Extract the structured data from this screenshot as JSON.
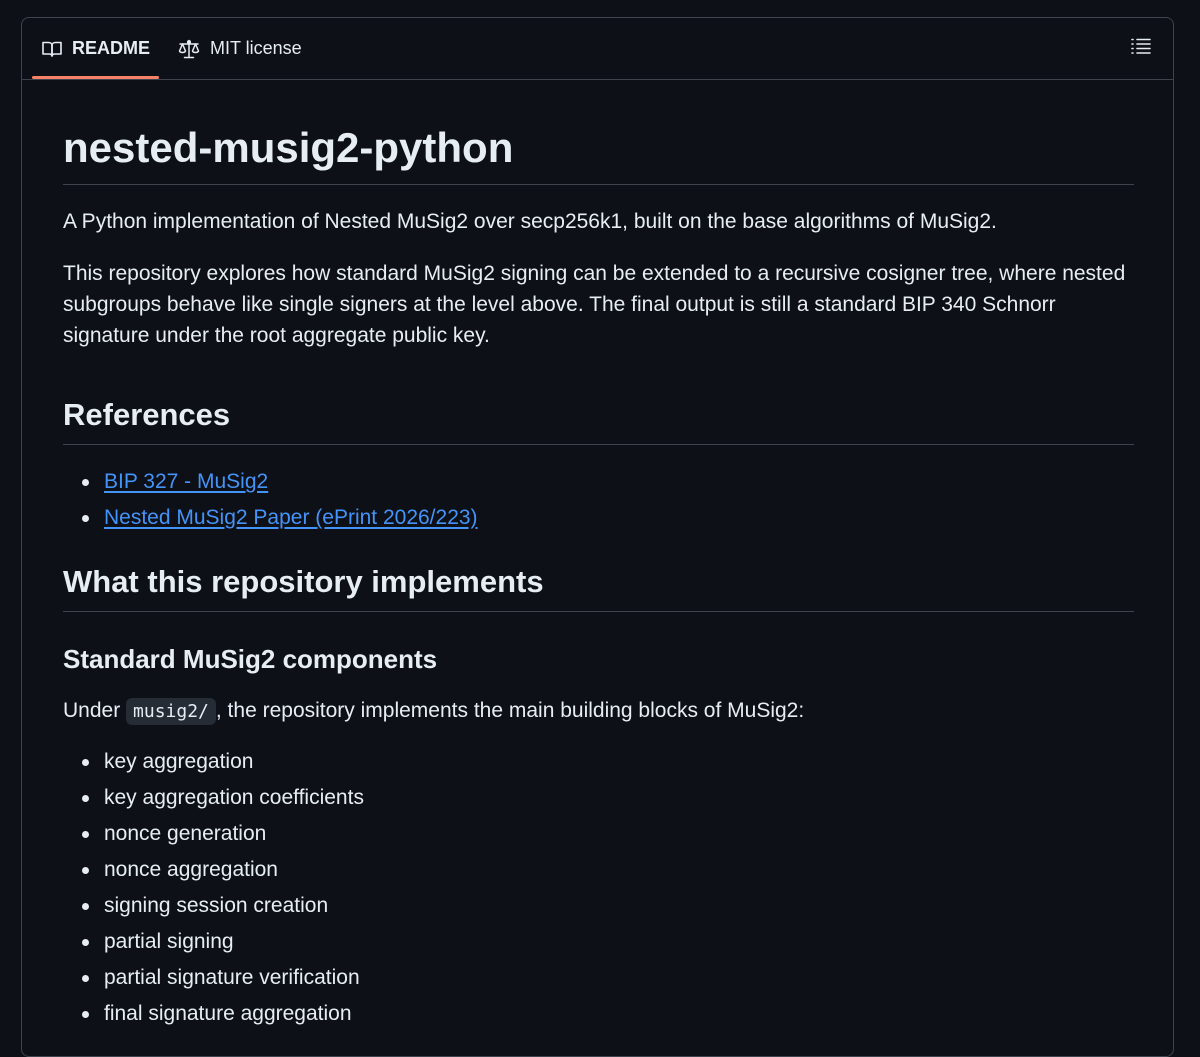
{
  "tabs": {
    "readme_label": "README",
    "license_label": "MIT license",
    "readme_icon": "book-icon",
    "license_icon": "law-icon",
    "outline_icon": "list-unordered-icon"
  },
  "readme": {
    "title": "nested-musig2-python",
    "intro": "A Python implementation of Nested MuSig2 over secp256k1, built on the base algorithms of MuSig2.",
    "description": "This repository explores how standard MuSig2 signing can be extended to a recursive cosigner tree, where nested subgroups behave like single signers at the level above. The final output is still a standard BIP 340 Schnorr signature under the root aggregate public key.",
    "references_heading": "References",
    "references": [
      {
        "label": "BIP 327 - MuSig2"
      },
      {
        "label": "Nested MuSig2 Paper (ePrint 2026/223)"
      }
    ],
    "implements_heading": "What this repository implements",
    "components_heading": "Standard MuSig2 components",
    "components_intro_before": "Under ",
    "components_intro_code": "musig2/",
    "components_intro_after": ", the repository implements the main building blocks of MuSig2:",
    "components": [
      "key aggregation",
      "key aggregation coefficients",
      "nonce generation",
      "nonce aggregation",
      "signing session creation",
      "partial signing",
      "partial signature verification",
      "final signature aggregation"
    ]
  },
  "colors": {
    "background": "#0d1117",
    "border": "#3d444d",
    "text": "#e6edf3",
    "link": "#4493f8",
    "tab_accent": "#f78166"
  }
}
